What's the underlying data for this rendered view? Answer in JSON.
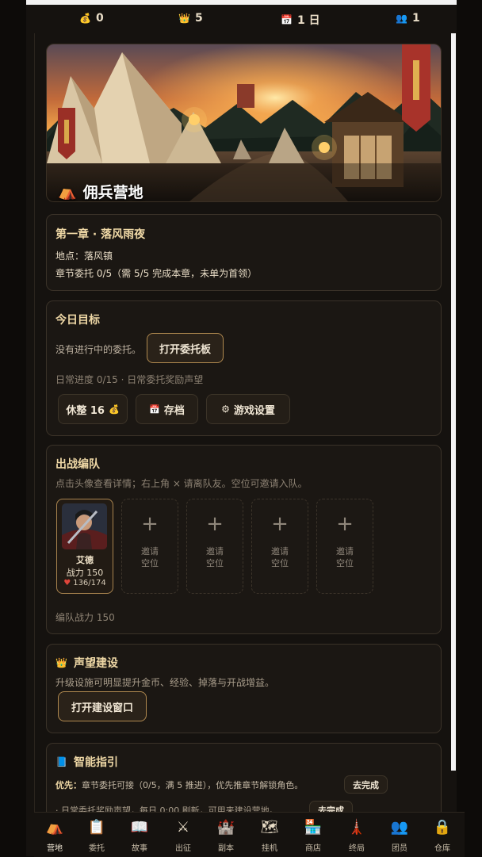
{
  "status": {
    "gold": "0",
    "crowns": "5",
    "day": "1 日",
    "members": "1"
  },
  "hero": {
    "title": "佣兵营地"
  },
  "chapter": {
    "title": "第一章 · 落风雨夜",
    "location": "地点：落风镇",
    "progress": "章节委托 0/5（需 5/5 完成本章，未单为首领）"
  },
  "daily": {
    "title": "今日目标",
    "no_task": "没有进行中的委托。",
    "open_board": "打开委托板",
    "progress": "日常进度 0/15 · 日常委托奖励声望",
    "rest": "休整 16",
    "save": "存档",
    "settings": "游戏设置"
  },
  "team": {
    "title": "出战编队",
    "hint": "点击头像查看详情；右上角 × 请离队友。空位可邀请入队。",
    "member": {
      "name": "艾德",
      "power": "战力 150",
      "hp": "136/174",
      "hp_fraction": 0.78
    },
    "slot_label_1": "邀请",
    "slot_label_2": "空位",
    "total_power": "编队战力 150"
  },
  "reputation": {
    "title": "声望建设",
    "desc": "升级设施可明显提升金币、经验、掉落与开战增益。",
    "button": "打开建设窗口"
  },
  "guide": {
    "title": "智能指引",
    "priority_label": "优先：",
    "priority_text": "章节委托可接（0/5，满 5 推进），优先推章节解锁角色。",
    "go_button": "去完成",
    "daily_text": "· 日常委托奖励声望，每日 0:00 刷新，可用来建设营地。",
    "go_button_2": "去完成"
  },
  "nav": [
    {
      "label": "营地",
      "icon": "camp-icon"
    },
    {
      "label": "委托",
      "icon": "scroll-icon"
    },
    {
      "label": "故事",
      "icon": "book-icon"
    },
    {
      "label": "出征",
      "icon": "swords-icon"
    },
    {
      "label": "副本",
      "icon": "castle-icon"
    },
    {
      "label": "挂机",
      "icon": "map-icon"
    },
    {
      "label": "商店",
      "icon": "shop-icon"
    },
    {
      "label": "终局",
      "icon": "tower-icon"
    },
    {
      "label": "团员",
      "icon": "people-icon"
    },
    {
      "label": "仓库",
      "icon": "lock-icon"
    }
  ],
  "colors": {
    "accent": "#b0894f",
    "background": "#15120f",
    "card": "#1b1713",
    "title": "#efd8a6"
  }
}
